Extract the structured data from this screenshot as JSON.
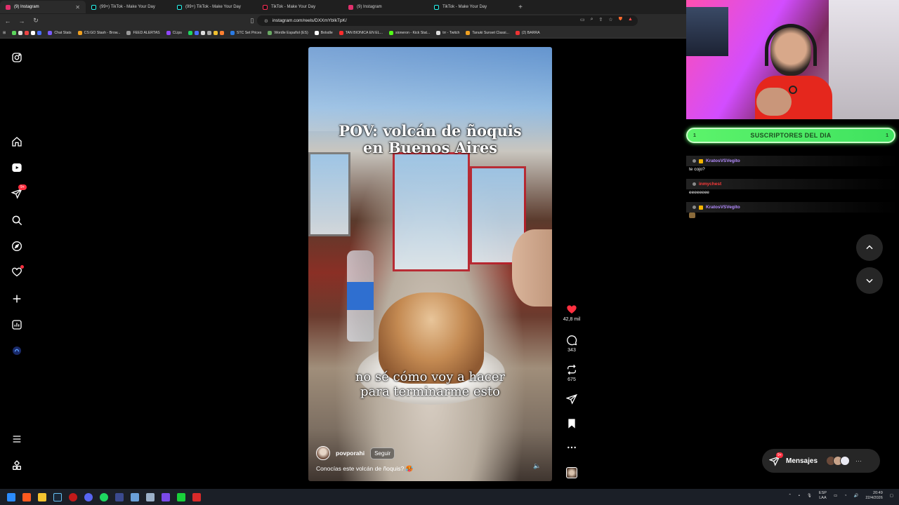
{
  "browser": {
    "tabs": [
      {
        "label": "(9) Instagram",
        "active": true
      },
      {
        "label": "(99+) TikTok - Make Your Day"
      },
      {
        "label": "(99+) TikTok - Make Your Day"
      },
      {
        "label": "TikTok - Make Your Day"
      },
      {
        "label": "(9) Instagram"
      },
      {
        "label": "TikTok - Make Your Day"
      }
    ],
    "new_tab": "+",
    "url": "instagram.com/reels/DXXmYbIkTpK/",
    "bookmarks": [
      "Chat Stats",
      "CS:GO Stash - Brow...",
      "FEED ALERTAS",
      "CLips",
      "STC Set Prices",
      "Wordle Español (ES)",
      "Bolsdle",
      "TAN BIONICA EN EL...",
      "sioneron - Kick Stat...",
      "trr - Twitch",
      "Tanuki Sunset Classi...",
      "(2) BARRA"
    ]
  },
  "sidebar": {
    "items": [
      {
        "name": "instagram-logo-icon"
      },
      {
        "name": "home-icon"
      },
      {
        "name": "reels-icon"
      },
      {
        "name": "direct-messages-icon",
        "badge": "9+"
      },
      {
        "name": "search-icon"
      },
      {
        "name": "explore-icon"
      },
      {
        "name": "notifications-heart-icon",
        "dot": true
      },
      {
        "name": "create-plus-icon"
      },
      {
        "name": "dashboard-icon"
      },
      {
        "name": "profile-avatar-icon"
      },
      {
        "name": "more-menu-icon"
      },
      {
        "name": "also-from-meta-icon"
      }
    ],
    "dm_badge": "9+"
  },
  "reel": {
    "caption_top_line1": "POV: volcán de ñoquis",
    "caption_top_line2": "en Buenos Aires",
    "caption_bottom_line1": "no sé cómo voy a hacer",
    "caption_bottom_line2": "para terminarme esto",
    "username": "povporahi",
    "follow_label": "Seguir",
    "description": "Conocías este volcán de ñoquis? 🥵"
  },
  "actions": {
    "likes": "42,8 mil",
    "comments": "343",
    "reposts": "675",
    "like_color": "#ff3040"
  },
  "messages": {
    "label": "Mensajes",
    "badge": "9+"
  },
  "stream_overlay": {
    "subs_title": "SUSCRIPTORES DEL DIA",
    "subs_left": "1",
    "subs_right": "1",
    "chat": [
      {
        "user": "KratosVSVegito",
        "message": "te cojo?",
        "color": "#b48cff"
      },
      {
        "user": "inmychest",
        "message": "eeeeeeee",
        "color": "#ff3b3b"
      },
      {
        "user": "KratosVSVegito",
        "message": "",
        "color": "#b48cff"
      }
    ]
  },
  "taskbar": {
    "lang_top": "ESP",
    "lang_bottom": "LAA",
    "time": "20:49",
    "date": "22/4/2026"
  }
}
